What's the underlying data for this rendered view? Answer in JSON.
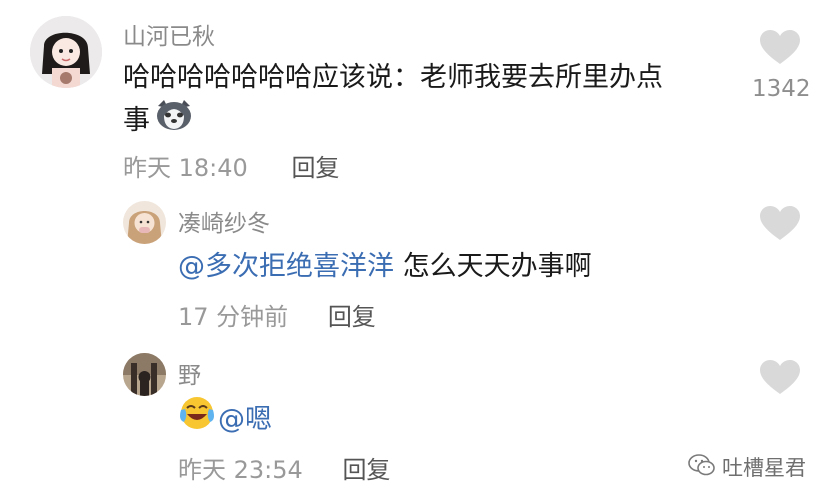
{
  "comments": [
    {
      "username": "山河已秋",
      "text_line1": "哈哈哈哈哈哈哈应该说：老师我要去所里办点",
      "text_line2": "事",
      "emoji": "husky-emoji",
      "time": "昨天 18:40",
      "reply_label": "回复",
      "likes": "1342"
    },
    {
      "username": "凑崎纱冬",
      "mention": "@多次拒绝喜洋洋",
      "text": " 怎么天天办事啊",
      "time": "17 分钟前",
      "reply_label": "回复"
    },
    {
      "username": "野",
      "emoji": "laughing-crying-emoji",
      "mention": "@嗯",
      "time": "昨天 23:54",
      "reply_label": "回复"
    }
  ],
  "watermark": {
    "icon": "wechat-official-account-icon",
    "label": "吐槽星君"
  },
  "colors": {
    "mention": "#3b6db3",
    "meta": "#999999",
    "heart": "#d9d9d9"
  }
}
